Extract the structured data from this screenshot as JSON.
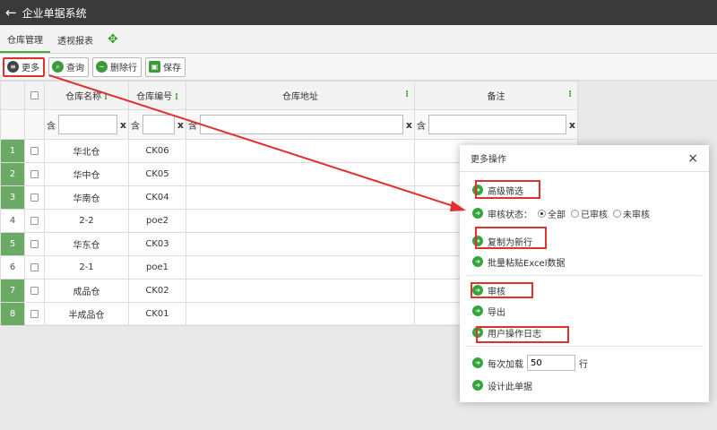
{
  "app": {
    "title": "企业单据系统",
    "back_icon": "back-arrow-icon"
  },
  "tabs": [
    {
      "label": "仓库管理",
      "active": true
    },
    {
      "label": "透视报表",
      "active": false
    }
  ],
  "tab_extra_icon": "move-icon",
  "toolbar": {
    "more_label": "更多",
    "query_label": "查询",
    "delete_row_label": "删除行",
    "save_label": "保存"
  },
  "table": {
    "columns": [
      "仓库名称",
      "仓库编号",
      "仓库地址",
      "备注"
    ],
    "filter_prefix": "含",
    "filter_clear": "x",
    "rows": [
      {
        "num": "1",
        "name": "华北仓",
        "code": "CK06",
        "green": true
      },
      {
        "num": "2",
        "name": "华中仓",
        "code": "CK05",
        "green": true
      },
      {
        "num": "3",
        "name": "华南仓",
        "code": "CK04",
        "green": true
      },
      {
        "num": "4",
        "name": "2-2",
        "code": "poe2",
        "green": false
      },
      {
        "num": "5",
        "name": "华东仓",
        "code": "CK03",
        "green": true
      },
      {
        "num": "6",
        "name": "2-1",
        "code": "poe1",
        "green": false
      },
      {
        "num": "7",
        "name": "成品仓",
        "code": "CK02",
        "green": true
      },
      {
        "num": "8",
        "name": "半成品仓",
        "code": "CK01",
        "green": true
      }
    ]
  },
  "modal": {
    "title": "更多操作",
    "close": "×",
    "advanced_filter": "高级筛选",
    "audit_status_label": "审核状态：",
    "audit_options": [
      "全部",
      "已审核",
      "未审核"
    ],
    "audit_selected": "全部",
    "copy_new_row": "复制为新行",
    "batch_paste": "批量粘贴Excel数据",
    "audit": "审核",
    "export": "导出",
    "user_log": "用户操作日志",
    "per_load_prefix": "每次加载",
    "per_load_value": "50",
    "per_load_suffix": "行",
    "design": "设计此单据"
  },
  "colors": {
    "accent_green": "#37a53e",
    "highlight_red": "#e03030",
    "titlebar": "#3a3a3a"
  }
}
